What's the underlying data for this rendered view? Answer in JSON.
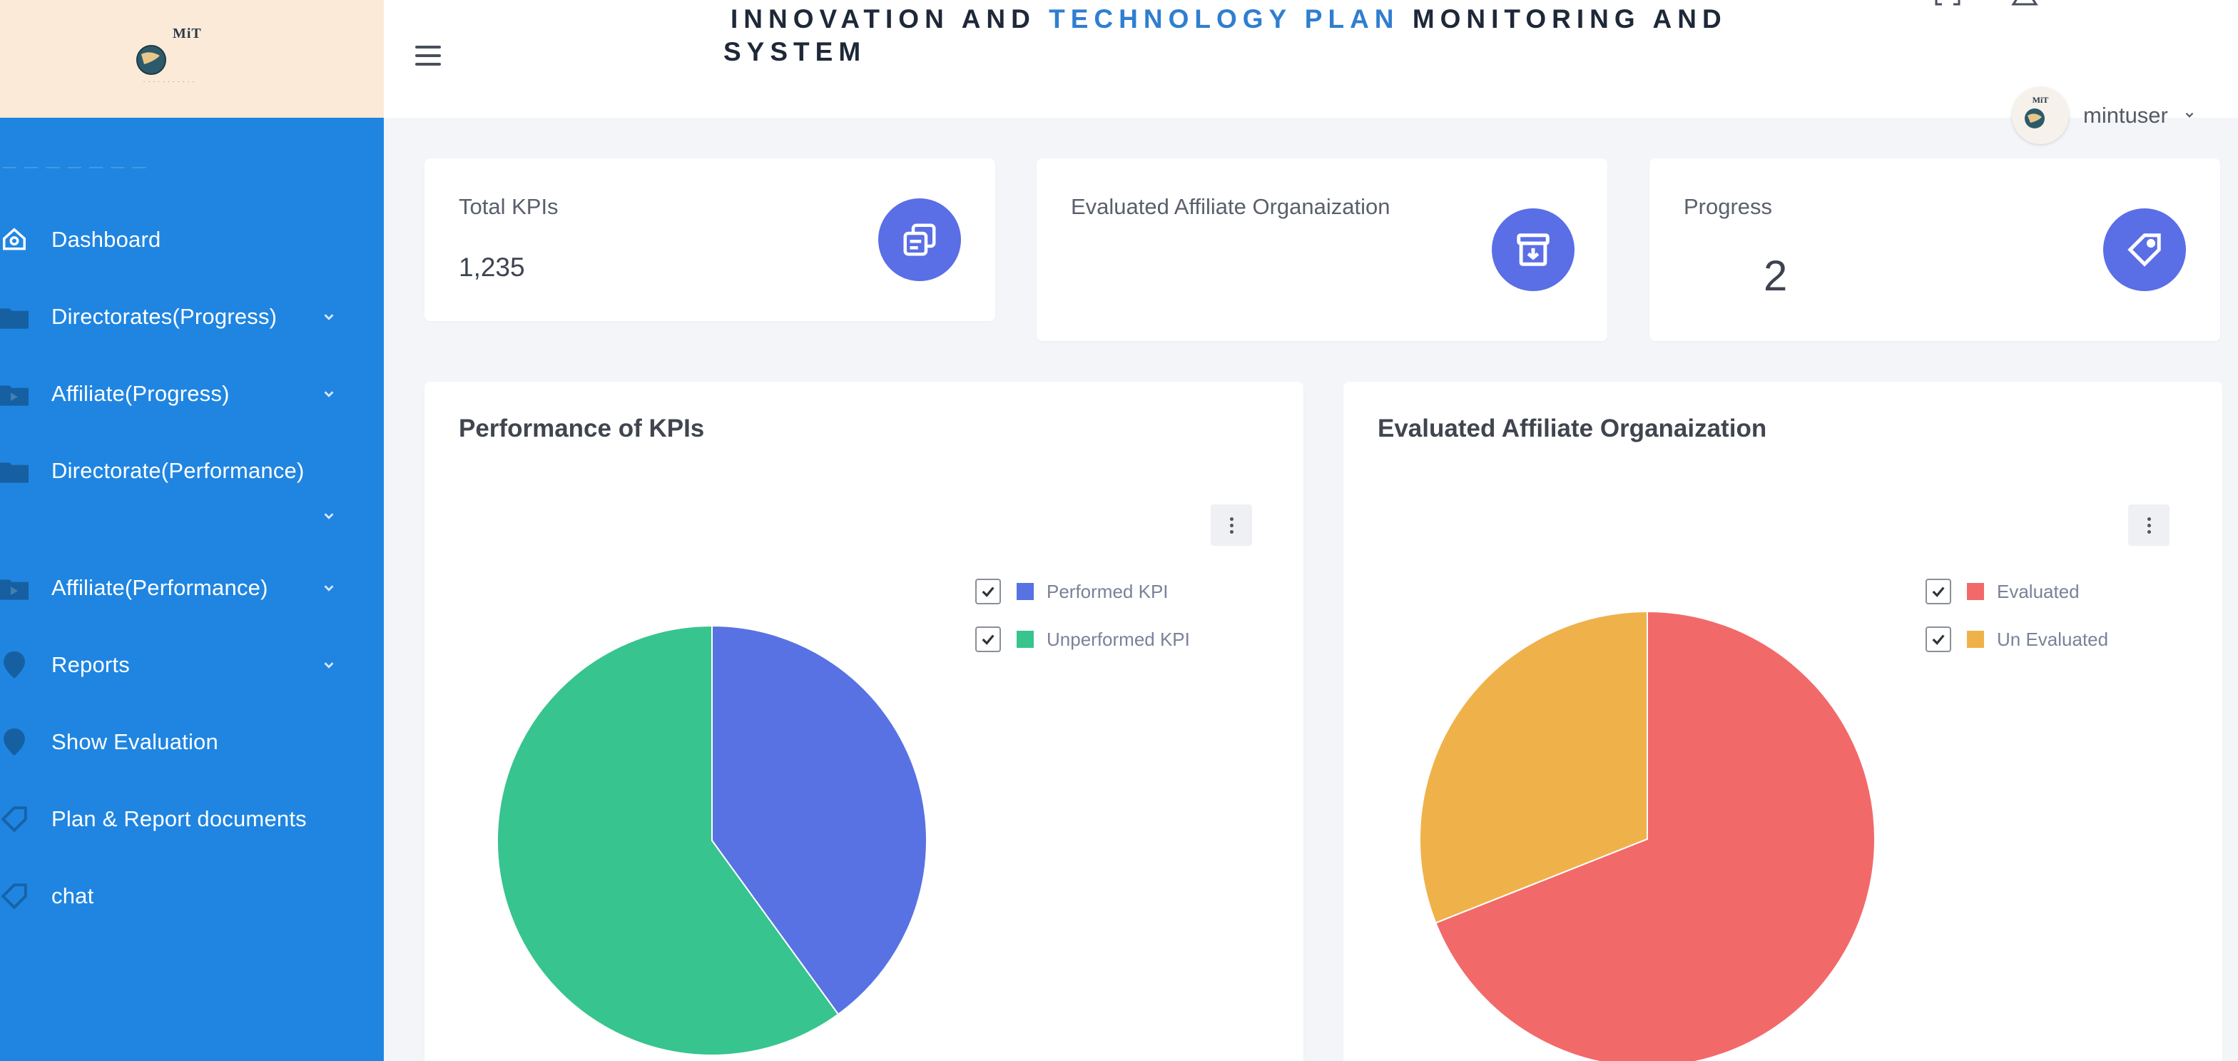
{
  "header": {
    "title_line1": [
      "INNOVATION AND ",
      "TECHNOLOGY PLAN",
      " MONITORING AND"
    ],
    "title_line2": "SYSTEM",
    "username": "mintuser",
    "logo_text": "MiT"
  },
  "sidebar": {
    "items": [
      {
        "label": "Dashboard",
        "icon": "home-icon",
        "chevron": false
      },
      {
        "label": "Directorates(Progress)",
        "icon": "folder-icon",
        "chevron": true
      },
      {
        "label": "Affiliate(Progress)",
        "icon": "folder-video-icon",
        "chevron": true
      },
      {
        "label": "Directorate(Performance)",
        "icon": "folder-icon",
        "chevron": true
      },
      {
        "label": "Affiliate(Performance)",
        "icon": "folder-video-icon",
        "chevron": true
      },
      {
        "label": "Reports",
        "icon": "location-pin-icon",
        "chevron": true
      },
      {
        "label": "Show Evaluation",
        "icon": "location-pin-icon",
        "chevron": false
      },
      {
        "label": "Plan & Report documents",
        "icon": "tag-icon",
        "chevron": false
      },
      {
        "label": "chat",
        "icon": "tag-icon",
        "chevron": false
      }
    ]
  },
  "stats": [
    {
      "label": "Total KPIs",
      "value": "1,235",
      "icon": "copy-icon"
    },
    {
      "label": "Evaluated Affiliate Organaization",
      "value": "",
      "icon": "archive-download-icon"
    },
    {
      "label": "Progress",
      "value": "2",
      "icon": "price-tag-icon"
    }
  ],
  "colors": {
    "sidebar": "#1f85e1",
    "logo_bg": "#fbead7",
    "accent_icon": "#5a6ee6",
    "performed": "#5872e3",
    "unperformed": "#37c48f",
    "evaluated": "#f26969",
    "un_evaluated": "#efb24a"
  },
  "chart_data": [
    {
      "type": "pie",
      "title": "Performance of KPIs",
      "legend": "top-right",
      "slices": [
        {
          "label": "Performed KPI",
          "value": 40,
          "color": "#5872e3"
        },
        {
          "label": "Unperformed KPI",
          "value": 60,
          "color": "#37c48f"
        }
      ]
    },
    {
      "type": "pie",
      "title": "Evaluated Affiliate Organaization",
      "legend": "top-right",
      "slices": [
        {
          "label": "Evaluated",
          "value": 69,
          "color": "#f26969"
        },
        {
          "label": "Un Evaluated",
          "value": 31,
          "color": "#efb24a"
        }
      ]
    }
  ]
}
